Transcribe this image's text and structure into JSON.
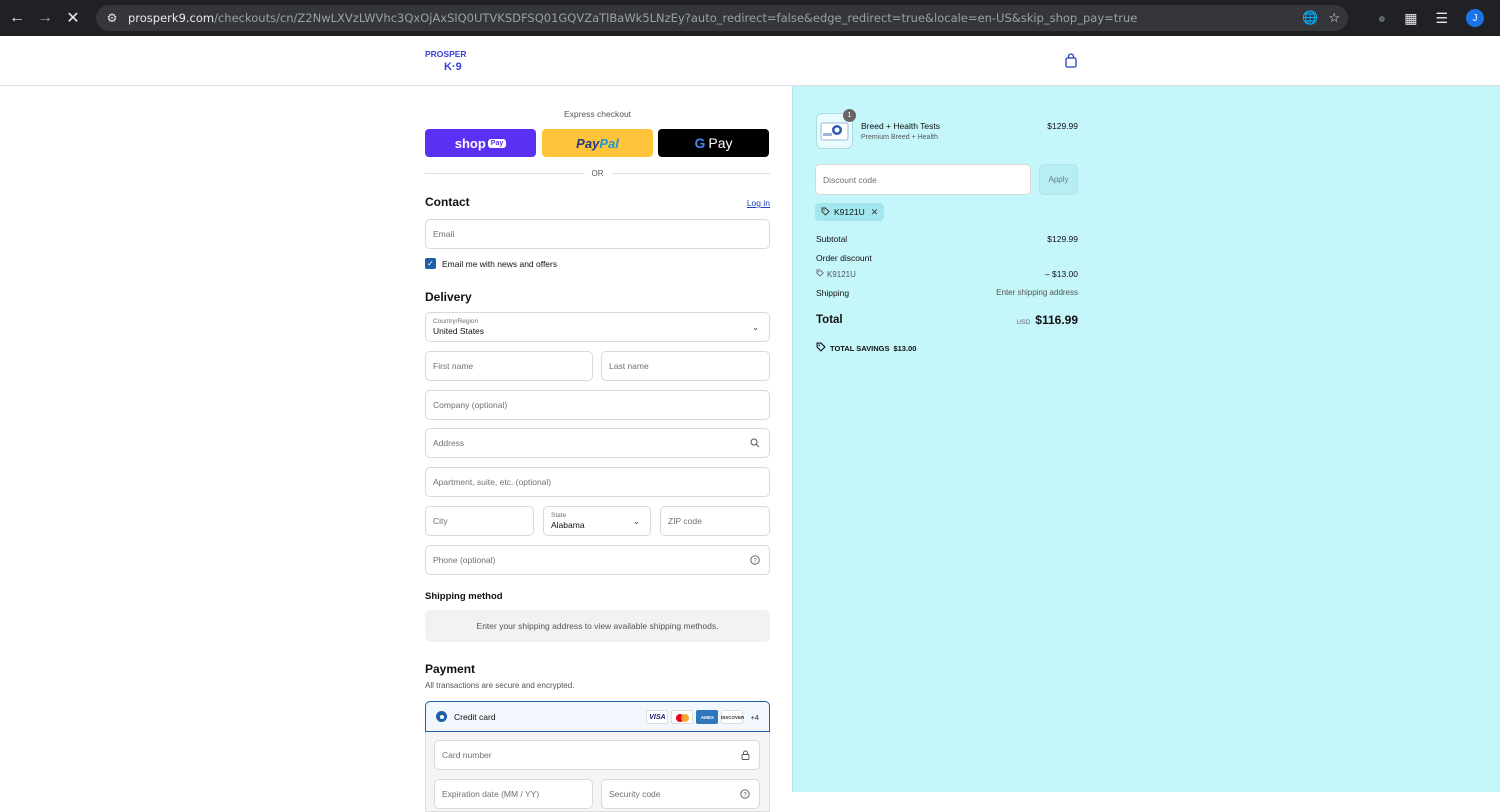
{
  "browser": {
    "url_host": "prosperk9.com",
    "url_path": "/checkouts/cn/Z2NwLXVzLWVhc3QxOjAxSlQ0UTVKSDFSQ01GQVZaTlBaWk5LNzEy?auto_redirect=false&edge_redirect=true&locale=en-US&skip_shop_pay=true",
    "profile_initial": "J"
  },
  "header": {
    "logo_top": "PROSPER",
    "logo_bottom": "K·9"
  },
  "express": {
    "title": "Express checkout",
    "shop_label": "shop",
    "shop_pay_pill": "Pay",
    "paypal_pay": "Pay",
    "paypal_pal": "Pal",
    "gpay_g": "G",
    "gpay_label": "Pay",
    "or_label": "OR"
  },
  "contact": {
    "title": "Contact",
    "login_link": "Log in",
    "email_placeholder": "Email",
    "newsletter_label": "Email me with news and offers",
    "newsletter_checked": true
  },
  "delivery": {
    "title": "Delivery",
    "country_label": "Country/Region",
    "country_value": "United States",
    "first_name_placeholder": "First name",
    "last_name_placeholder": "Last name",
    "company_placeholder": "Company (optional)",
    "address_placeholder": "Address",
    "apartment_placeholder": "Apartment, suite, etc. (optional)",
    "city_placeholder": "City",
    "state_label": "State",
    "state_value": "Alabama",
    "zip_placeholder": "ZIP code",
    "phone_placeholder": "Phone (optional)"
  },
  "shipping_method": {
    "title": "Shipping method",
    "message": "Enter your shipping address to view available shipping methods."
  },
  "payment": {
    "title": "Payment",
    "subtitle": "All transactions are secure and encrypted.",
    "credit_card_label": "Credit card",
    "card_brands": [
      "VISA",
      "MC",
      "AMEX",
      "DISCOVER"
    ],
    "more_brands": "+4",
    "card_number_placeholder": "Card number",
    "expiration_placeholder": "Expiration date (MM / YY)",
    "security_code_placeholder": "Security code"
  },
  "summary": {
    "item": {
      "quantity": "1",
      "name": "Breed + Health Tests",
      "variant": "Premium Breed + Health",
      "price": "$129.99"
    },
    "discount_placeholder": "Discount code",
    "apply_label": "Apply",
    "applied_code": "K9121U",
    "subtotal_label": "Subtotal",
    "subtotal_value": "$129.99",
    "order_discount_label": "Order discount",
    "order_discount_code": "K9121U",
    "order_discount_value": "– $13.00",
    "shipping_label": "Shipping",
    "shipping_value": "Enter shipping address",
    "total_label": "Total",
    "total_currency": "USD",
    "total_value": "$116.99",
    "savings_label": "TOTAL SAVINGS",
    "savings_value": "$13.00"
  },
  "colors": {
    "summary_bg": "#c4f6fa",
    "accent": "#1e5fa8",
    "shop_pay": "#5a31f4",
    "paypal": "#ffc439"
  }
}
